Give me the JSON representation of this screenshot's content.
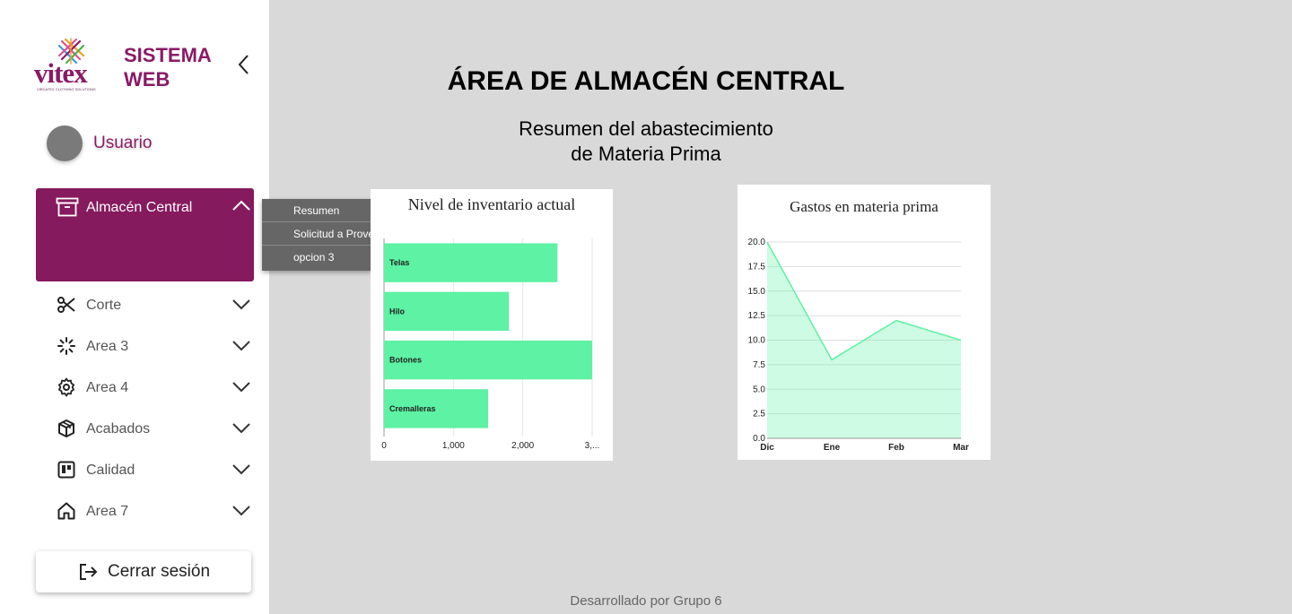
{
  "brand": {
    "logo_text": "vitex",
    "logo_sub": "VIRCATEX CLOTHING SOLUTIONS",
    "title_line1": "SISTEMA",
    "title_line2": "WEB"
  },
  "user": {
    "name": "Usuario"
  },
  "sidebar": {
    "active": {
      "label": "Almacén Central",
      "icon": "archive-icon"
    },
    "items": [
      {
        "label": "Corte",
        "icon": "scissors-icon"
      },
      {
        "label": "Area 3",
        "icon": "loader-icon"
      },
      {
        "label": "Area 4",
        "icon": "gear-icon"
      },
      {
        "label": "Acabados",
        "icon": "box-icon"
      },
      {
        "label": "Calidad",
        "icon": "board-icon"
      },
      {
        "label": "Area 7",
        "icon": "home-icon"
      }
    ],
    "logout_label": "Cerrar sesión"
  },
  "submenu": {
    "items": [
      "Resumen",
      "Solicitud a Proveedor",
      "opcion 3"
    ]
  },
  "main": {
    "title": "ÁREA DE ALMACÉN CENTRAL",
    "subtitle_line1": "Resumen del abastecimiento",
    "subtitle_line2": "de Materia Prima",
    "footer": "Desarrollado por Grupo 6"
  },
  "colors": {
    "brand": "#861a5e",
    "chart_fill": "#5df2a4"
  },
  "chart_data": [
    {
      "type": "bar",
      "orientation": "horizontal",
      "title": "Nivel de inventario actual",
      "categories": [
        "Telas",
        "Hilo",
        "Botones",
        "Cremalleras"
      ],
      "values": [
        2500,
        1800,
        3000,
        1500
      ],
      "xlim": [
        0,
        3000
      ],
      "xticks": [
        "0",
        "1,000",
        "2,000",
        "3,..."
      ],
      "grid": true
    },
    {
      "type": "area",
      "title": "Gastos en materia prima",
      "x": [
        "Dic",
        "Ene",
        "Feb",
        "Mar"
      ],
      "values": [
        20,
        8,
        12,
        10
      ],
      "ylim": [
        0,
        20
      ],
      "yticks": [
        "0.0",
        "2.5",
        "5.0",
        "7.5",
        "10.0",
        "12.5",
        "15.0",
        "17.5",
        "20.0"
      ],
      "grid": true
    }
  ]
}
